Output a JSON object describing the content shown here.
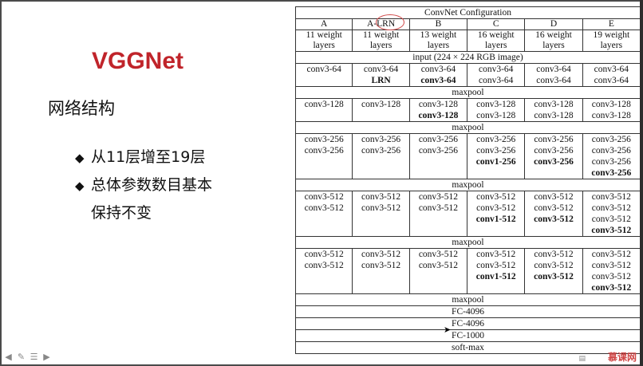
{
  "slide": {
    "title": "VGGNet",
    "subtitle": "网络结构",
    "bullets": [
      {
        "text": "从11层增至19层"
      },
      {
        "text": "总体参数数目基本"
      },
      {
        "text": "保持不变"
      }
    ],
    "bullet_symbol": "◆"
  },
  "table": {
    "caption": "ConvNet Configuration",
    "columns": [
      {
        "name": "A",
        "depth": "11 weight",
        "unit": "layers"
      },
      {
        "name": "A-LRN",
        "depth": "11 weight",
        "unit": "layers"
      },
      {
        "name": "B",
        "depth": "13 weight",
        "unit": "layers"
      },
      {
        "name": "C",
        "depth": "16 weight",
        "unit": "layers"
      },
      {
        "name": "D",
        "depth": "16 weight",
        "unit": "layers"
      },
      {
        "name": "E",
        "depth": "19 weight",
        "unit": "layers"
      }
    ],
    "input": "input (224 × 224 RGB image)",
    "maxpool": "maxpool",
    "blocks": [
      [
        [
          "conv3-64"
        ],
        [
          "conv3-64",
          "LRN"
        ],
        [
          "conv3-64",
          "conv3-64"
        ],
        [
          "conv3-64",
          "conv3-64"
        ],
        [
          "conv3-64",
          "conv3-64"
        ],
        [
          "conv3-64",
          "conv3-64"
        ]
      ],
      [
        [
          "conv3-128"
        ],
        [
          "conv3-128"
        ],
        [
          "conv3-128",
          "conv3-128"
        ],
        [
          "conv3-128",
          "conv3-128"
        ],
        [
          "conv3-128",
          "conv3-128"
        ],
        [
          "conv3-128",
          "conv3-128"
        ]
      ],
      [
        [
          "conv3-256",
          "conv3-256"
        ],
        [
          "conv3-256",
          "conv3-256"
        ],
        [
          "conv3-256",
          "conv3-256"
        ],
        [
          "conv3-256",
          "conv3-256",
          "conv1-256"
        ],
        [
          "conv3-256",
          "conv3-256",
          "conv3-256"
        ],
        [
          "conv3-256",
          "conv3-256",
          "conv3-256",
          "conv3-256"
        ]
      ],
      [
        [
          "conv3-512",
          "conv3-512"
        ],
        [
          "conv3-512",
          "conv3-512"
        ],
        [
          "conv3-512",
          "conv3-512"
        ],
        [
          "conv3-512",
          "conv3-512",
          "conv1-512"
        ],
        [
          "conv3-512",
          "conv3-512",
          "conv3-512"
        ],
        [
          "conv3-512",
          "conv3-512",
          "conv3-512",
          "conv3-512"
        ]
      ],
      [
        [
          "conv3-512",
          "conv3-512"
        ],
        [
          "conv3-512",
          "conv3-512"
        ],
        [
          "conv3-512",
          "conv3-512"
        ],
        [
          "conv3-512",
          "conv3-512",
          "conv1-512"
        ],
        [
          "conv3-512",
          "conv3-512",
          "conv3-512"
        ],
        [
          "conv3-512",
          "conv3-512",
          "conv3-512",
          "conv3-512"
        ]
      ]
    ],
    "bold_cells": [
      [
        [],
        [
          1
        ],
        [
          1
        ],
        [],
        [],
        []
      ],
      [
        [],
        [],
        [
          1
        ],
        [],
        [],
        []
      ],
      [
        [],
        [],
        [],
        [
          2
        ],
        [
          2
        ],
        [
          3
        ]
      ],
      [
        [],
        [],
        [],
        [
          2
        ],
        [
          2
        ],
        [
          3
        ]
      ],
      [
        [],
        [],
        [],
        [
          2
        ],
        [
          2
        ],
        [
          3
        ]
      ]
    ],
    "tail": [
      "FC-4096",
      "FC-4096",
      "FC-1000",
      "soft-max"
    ]
  },
  "footer": {
    "watermark": "慕课网",
    "nav_icons": [
      "prev-arrow-icon",
      "pen-icon",
      "menu-icon",
      "next-arrow-icon"
    ]
  }
}
